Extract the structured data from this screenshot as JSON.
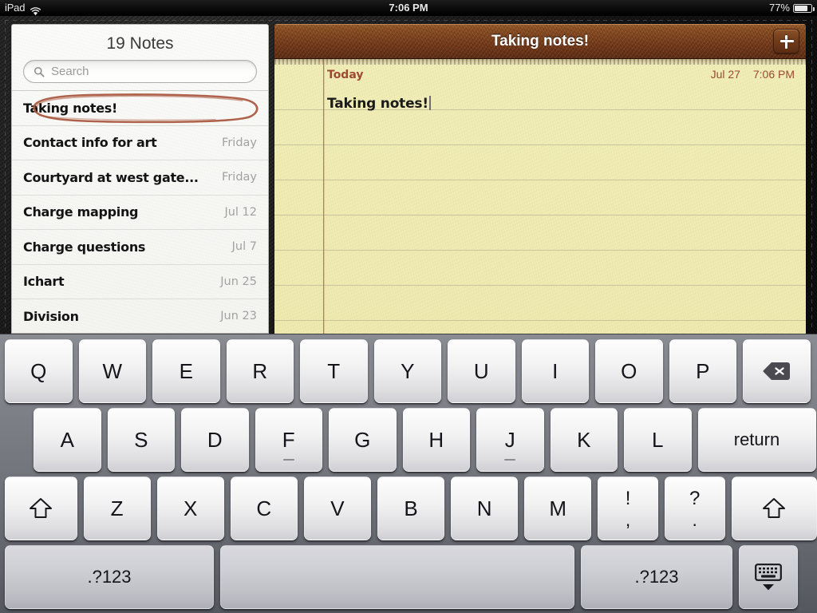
{
  "status_bar": {
    "carrier": "iPad",
    "wifi_icon": "wifi-icon",
    "time": "7:06 PM",
    "battery_percent": "77%",
    "battery_icon": "battery-icon"
  },
  "sidebar": {
    "header": "19 Notes",
    "search": {
      "placeholder": "Search",
      "value": "",
      "icon": "search-icon"
    },
    "notes": [
      {
        "title": "Taking notes!",
        "date": "",
        "selected": true
      },
      {
        "title": "Contact info for art",
        "date": "Friday",
        "selected": false
      },
      {
        "title": "Courtyard at west gate...",
        "date": "Friday",
        "selected": false
      },
      {
        "title": "Charge mapping",
        "date": "Jul 12",
        "selected": false
      },
      {
        "title": "Charge questions",
        "date": "Jul 7",
        "selected": false
      },
      {
        "title": "Ichart",
        "date": "Jun 25",
        "selected": false
      },
      {
        "title": "Division",
        "date": "Jun 23",
        "selected": false
      }
    ]
  },
  "note_detail": {
    "title": "Taking notes!",
    "add_button_icon": "plus-icon",
    "day_label": "Today",
    "date": "Jul 27",
    "time": "7:06 PM",
    "body": "Taking notes!"
  },
  "keyboard": {
    "row1": [
      {
        "label": "Q",
        "type": "letter"
      },
      {
        "label": "W",
        "type": "letter"
      },
      {
        "label": "E",
        "type": "letter"
      },
      {
        "label": "R",
        "type": "letter"
      },
      {
        "label": "T",
        "type": "letter"
      },
      {
        "label": "Y",
        "type": "letter"
      },
      {
        "label": "U",
        "type": "letter"
      },
      {
        "label": "I",
        "type": "letter"
      },
      {
        "label": "O",
        "type": "letter"
      },
      {
        "label": "P",
        "type": "letter"
      },
      {
        "label": "",
        "type": "backspace",
        "icon": "backspace-icon"
      }
    ],
    "row2": [
      {
        "label": "A",
        "type": "letter"
      },
      {
        "label": "S",
        "type": "letter"
      },
      {
        "label": "D",
        "type": "letter"
      },
      {
        "label": "F",
        "type": "letter",
        "home": true
      },
      {
        "label": "G",
        "type": "letter"
      },
      {
        "label": "H",
        "type": "letter"
      },
      {
        "label": "J",
        "type": "letter",
        "home": true
      },
      {
        "label": "K",
        "type": "letter"
      },
      {
        "label": "L",
        "type": "letter"
      },
      {
        "label": "return",
        "type": "return"
      }
    ],
    "row3": [
      {
        "label": "",
        "type": "shift",
        "icon": "shift-icon"
      },
      {
        "label": "Z",
        "type": "letter"
      },
      {
        "label": "X",
        "type": "letter"
      },
      {
        "label": "C",
        "type": "letter"
      },
      {
        "label": "V",
        "type": "letter"
      },
      {
        "label": "B",
        "type": "letter"
      },
      {
        "label": "N",
        "type": "letter"
      },
      {
        "label": "M",
        "type": "letter"
      },
      {
        "label": "!",
        "sub": ",",
        "type": "dual"
      },
      {
        "label": "?",
        "sub": ".",
        "type": "dual"
      },
      {
        "label": "",
        "type": "shift",
        "icon": "shift-icon"
      }
    ],
    "row4": [
      {
        "label": ".?123",
        "type": "numeric"
      },
      {
        "label": "",
        "type": "space"
      },
      {
        "label": ".?123",
        "type": "numeric"
      },
      {
        "label": "",
        "type": "hide",
        "icon": "hide-keyboard-icon"
      }
    ]
  },
  "colors": {
    "leather_header": "#74391a",
    "paper": "#eeeab0",
    "rule_line": "#c9c49c",
    "margin_line": "#b06a50",
    "meta_text": "#9c4a33",
    "selection_scribble": "#a8553c",
    "keyboard_bg": "#7e8087"
  }
}
